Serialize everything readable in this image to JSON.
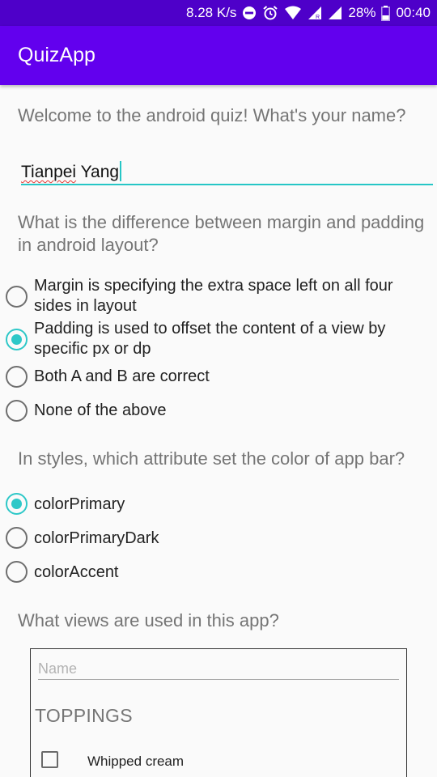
{
  "status_bar": {
    "network_speed": "8.28 K/s",
    "battery": "28%",
    "time": "00:40",
    "icons": [
      "do-not-disturb-icon",
      "alarm-icon",
      "wifi-icon",
      "cell-signal-roaming-icon",
      "cell-signal-icon",
      "battery-icon"
    ]
  },
  "app_bar": {
    "title": "QuizApp"
  },
  "quiz": {
    "welcome": "Welcome to the android quiz! What's your name?",
    "name_input": {
      "first_word": "Tianpei",
      "rest": " Yang"
    },
    "question1": {
      "text": "What is the difference between margin and padding in android layout?",
      "options": [
        {
          "label": "Margin is specifying the extra space left on all four sides in layout",
          "checked": false
        },
        {
          "label": "Padding is used to offset the content of a view by specific px or dp",
          "checked": true
        },
        {
          "label": "Both A and B are correct",
          "checked": false
        },
        {
          "label": "None of the above",
          "checked": false
        }
      ]
    },
    "question2": {
      "text": "In styles, which attribute set the color of app bar?",
      "options": [
        {
          "label": "colorPrimary",
          "checked": true
        },
        {
          "label": "colorPrimaryDark",
          "checked": false
        },
        {
          "label": "colorAccent",
          "checked": false
        }
      ]
    },
    "question3": {
      "text": "What views are used in this app?",
      "preview": {
        "input_placeholder": "Name",
        "section_heading": "TOPPINGS",
        "checkbox_label": "Whipped cream"
      }
    }
  },
  "colors": {
    "status_bar": "#4e00c9",
    "app_bar": "#6200ee",
    "accent": "#2ec8c8",
    "background": "#fafafa"
  }
}
